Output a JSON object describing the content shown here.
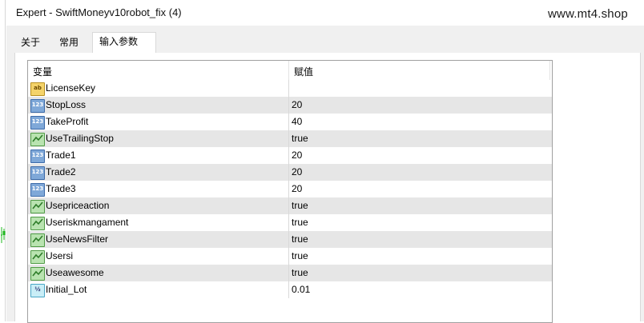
{
  "window": {
    "title": "Expert - SwiftMoneyv10robot_fix (4)",
    "watermark": "www.mt4.shop"
  },
  "tabs": [
    {
      "label": "关于",
      "active": false
    },
    {
      "label": "常用",
      "active": false
    },
    {
      "label": "输入参数",
      "active": true
    }
  ],
  "grid": {
    "headers": {
      "variable": "变量",
      "value": "赋值"
    },
    "rows": [
      {
        "icon": "string-ab-icon",
        "name": "LicenseKey",
        "value": ""
      },
      {
        "icon": "integer-123-icon",
        "name": "StopLoss",
        "value": "20"
      },
      {
        "icon": "integer-123-icon",
        "name": "TakeProfit",
        "value": "40"
      },
      {
        "icon": "boolean-icon",
        "name": "UseTrailingStop",
        "value": "true"
      },
      {
        "icon": "integer-123-icon",
        "name": "Trade1",
        "value": "20"
      },
      {
        "icon": "integer-123-icon",
        "name": "Trade2",
        "value": "20"
      },
      {
        "icon": "integer-123-icon",
        "name": "Trade3",
        "value": "20"
      },
      {
        "icon": "boolean-icon",
        "name": "Usepriceaction",
        "value": "true"
      },
      {
        "icon": "boolean-icon",
        "name": "Useriskmangament",
        "value": "true"
      },
      {
        "icon": "boolean-icon",
        "name": "UseNewsFilter",
        "value": "true"
      },
      {
        "icon": "boolean-icon",
        "name": "Usersi",
        "value": "true"
      },
      {
        "icon": "boolean-icon",
        "name": "Useawesome",
        "value": "true"
      },
      {
        "icon": "double-icon",
        "name": "Initial_Lot",
        "value": "0.01"
      }
    ]
  },
  "colors": {
    "row_shade": "#e6e6e6",
    "chart_fragment": "#1fb81f"
  }
}
